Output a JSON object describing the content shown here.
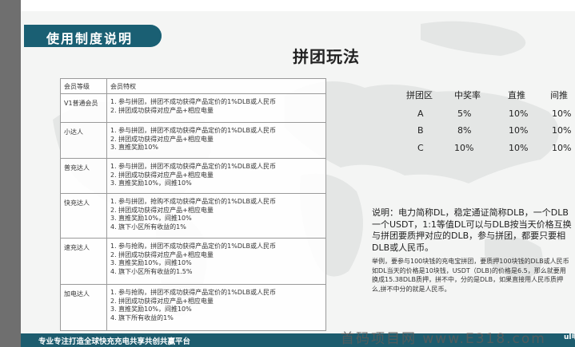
{
  "section_title": "使用制度说明",
  "heading": "拼团玩法",
  "member_table": {
    "headers": [
      "会员等级",
      "会员特权"
    ],
    "rows": [
      {
        "level": "V1普通会员",
        "perks": [
          "1. 参与拼团，拼团不成功获得产品定价的1%DLB或人民币",
          "2. 拼团成功获得对应产品+相应电量"
        ]
      },
      {
        "level": "小达人",
        "perks": [
          "1. 参与拼团，拼团不成功获得产品定价的1%DLB或人民币",
          "2. 拼团成功获得对应产品+相应电量",
          "3. 直推奖励10%"
        ]
      },
      {
        "level": "普充达人",
        "perks": [
          "1. 参与拼团，拼团不成功获得产品定价的1%DLB或人民币",
          "2. 拼团成功获得对应产品+相应电量",
          "3. 直推奖励10%，间推10%"
        ]
      },
      {
        "level": "快充达人",
        "perks": [
          "1. 参与拼团，抢购不成功获得产品定价的1%DLB或人民币",
          "2. 拼团成功获得对应产品+相应电量",
          "3. 直推奖励10%，间推10%",
          "4. 旗下小区所有收益的1%"
        ]
      },
      {
        "level": "速充达人",
        "perks": [
          "1. 参与抢购，拼团不成功获得产品定价的1%DLB或人民币",
          "2. 拼团成功获得对应产品+相应电量",
          "3. 直推奖励10%，间推10%",
          "4. 旗下小区所有收益的1.5%"
        ]
      },
      {
        "level": "加电达人",
        "perks": [
          "1. 参与抢购，拼团不成功获得产品定价的1%DLB或人民币",
          "2. 拼团成功获得对应产品+相应电量",
          "3. 直推奖励10%，间推10%",
          "4. 旗下所有收益的1%"
        ]
      }
    ]
  },
  "rate_table": {
    "headers": [
      "拼团区",
      "中奖率",
      "直推",
      "间推"
    ],
    "rows": [
      [
        "A",
        "5%",
        "10%",
        "10%"
      ],
      [
        "B",
        "8%",
        "10%",
        "10%"
      ],
      [
        "C",
        "10%",
        "10%",
        "10%"
      ]
    ]
  },
  "description": [
    "说明：电力简称DL，稳定通证简称DLB，一个DLB",
    "一个USDT，1:1等值DL可以与DLB按当天价格互换",
    "与拼团要质押对应的DLB，参与拼团，都要只要相",
    "DLB或人民币。"
  ],
  "example": [
    "举例，要参与100块钱的充电宝拼团，要质押100块钱的DLB或人民币",
    "如DL当天的价格是10块钱，USDT（DLB)的价格是6.5，那么就要用",
    "换成15.38DLB质押，拼不中，分的是DLB，如果直接用人民币质押",
    "么,拼不中分的就是人民币。"
  ],
  "footer": "专业专注打造全球快充充电共享共创共赢平台",
  "watermark": "首码项目网 www.E318.com",
  "watermark_logo": "ul电播",
  "colors": {
    "teal": "#1a5f73",
    "accent": "#4fb7c9",
    "footer": "#1d5c6e"
  }
}
